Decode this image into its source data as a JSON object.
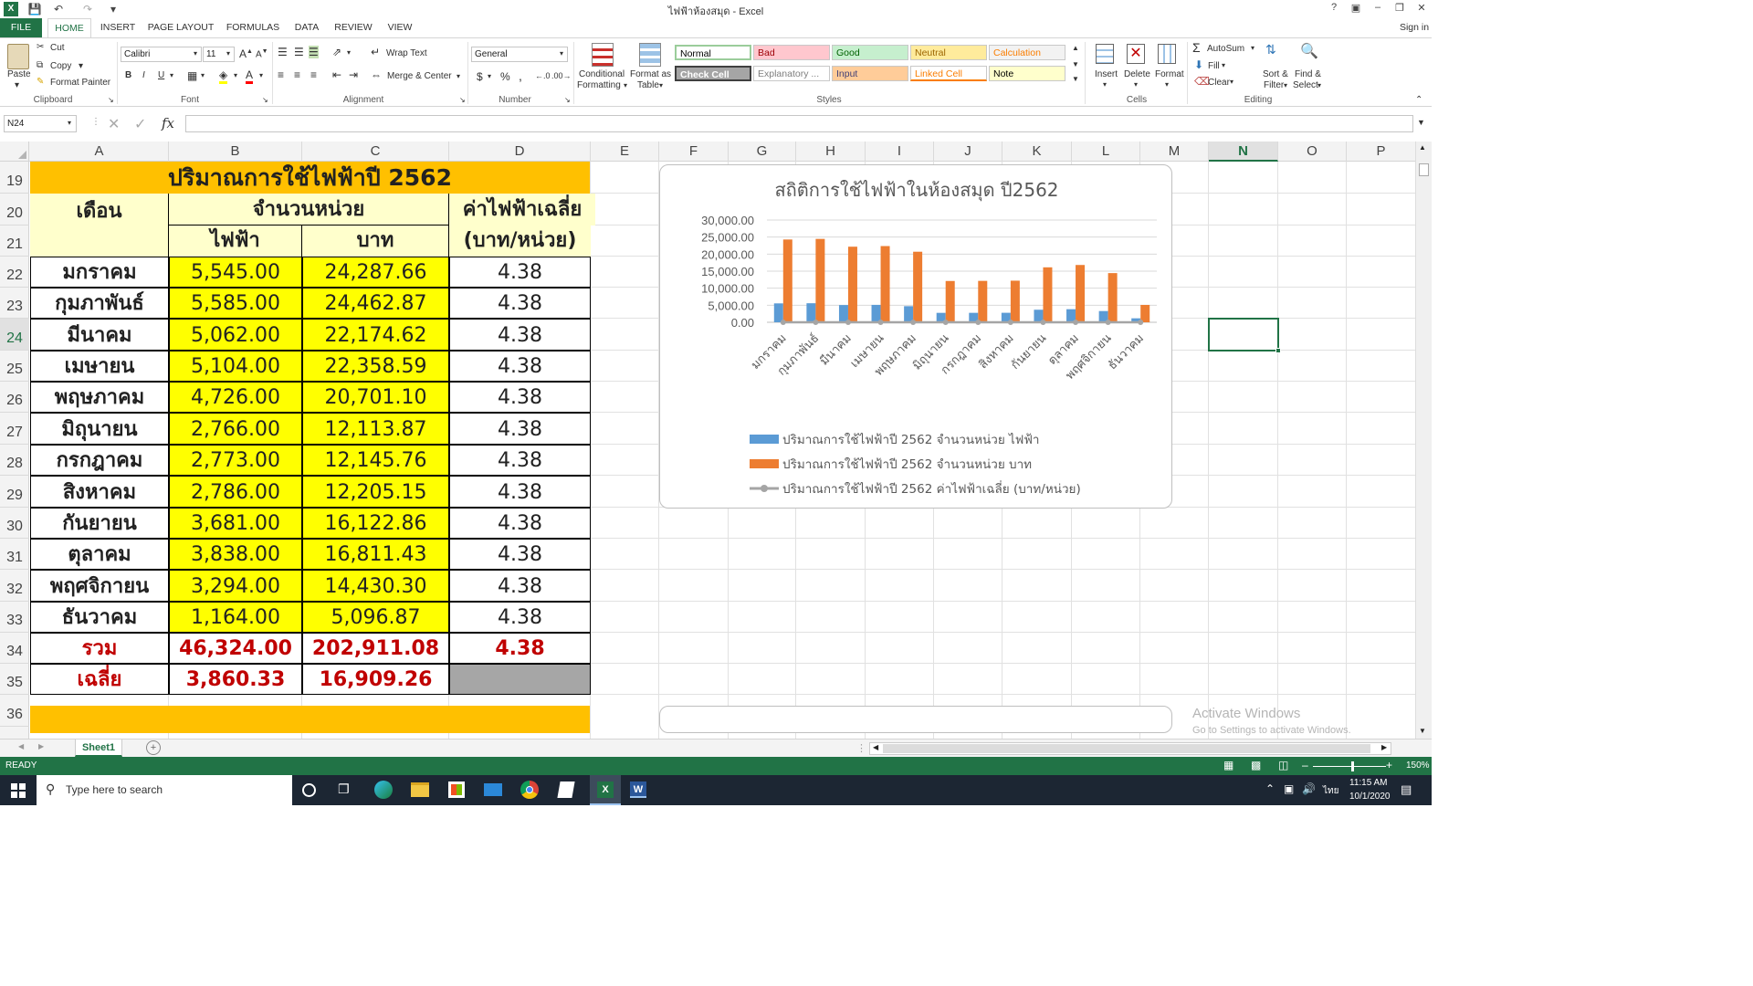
{
  "app": {
    "title": "ไฟฟ้าห้องสมุด - Excel",
    "help_icon": "?",
    "sign_in": "Sign in",
    "ribbon_tabs": [
      "FILE",
      "HOME",
      "INSERT",
      "PAGE LAYOUT",
      "FORMULAS",
      "DATA",
      "REVIEW",
      "VIEW"
    ]
  },
  "ribbon": {
    "clipboard": {
      "paste": "Paste",
      "cut": "Cut",
      "copy": "Copy",
      "format_painter": "Format Painter",
      "label": "Clipboard"
    },
    "font": {
      "name": "Calibri",
      "size": "11",
      "label": "Font"
    },
    "alignment": {
      "wrap": "Wrap Text",
      "merge": "Merge & Center",
      "label": "Alignment"
    },
    "number": {
      "format": "General",
      "label": "Number"
    },
    "styles": {
      "conditional": "Conditional",
      "conditional2": "Formatting",
      "format_as": "Format as",
      "format_as2": "Table",
      "cells": [
        {
          "name": "Normal",
          "bg": "#ffffff",
          "color": "#000000"
        },
        {
          "name": "Bad",
          "bg": "#ffc7ce",
          "color": "#9c0006"
        },
        {
          "name": "Good",
          "bg": "#c6efce",
          "color": "#006100"
        },
        {
          "name": "Neutral",
          "bg": "#ffeb9c",
          "color": "#9c6500"
        },
        {
          "name": "Calculation",
          "bg": "#f2f2f2",
          "color": "#fa7d00"
        },
        {
          "name": "Check Cell",
          "bg": "#a5a5a5",
          "color": "#ffffff"
        },
        {
          "name": "Explanatory ...",
          "bg": "#ffffff",
          "color": "#7f7f7f"
        },
        {
          "name": "Input",
          "bg": "#ffcc99",
          "color": "#3f3f76"
        },
        {
          "name": "Linked Cell",
          "bg": "#ffffff",
          "color": "#fa7d00"
        },
        {
          "name": "Note",
          "bg": "#ffffcc",
          "color": "#000000"
        }
      ],
      "label": "Styles"
    },
    "cells": {
      "insert": "Insert",
      "delete": "Delete",
      "format": "Format",
      "label": "Cells"
    },
    "editing": {
      "autosum": "AutoSum",
      "fill": "Fill",
      "clear": "Clear",
      "sort": "Sort &",
      "sort2": "Filter",
      "find": "Find &",
      "find2": "Select",
      "label": "Editing"
    }
  },
  "formula_bar": {
    "name_box": "N24",
    "fx": "fx",
    "content": ""
  },
  "columns": [
    "A",
    "B",
    "C",
    "D",
    "E",
    "F",
    "G",
    "H",
    "I",
    "J",
    "K",
    "L",
    "M",
    "N",
    "O",
    "P"
  ],
  "rows": [
    "19",
    "20",
    "21",
    "22",
    "23",
    "24",
    "25",
    "26",
    "27",
    "28",
    "29",
    "30",
    "31",
    "32",
    "33",
    "34",
    "35",
    "36"
  ],
  "table": {
    "title": "ปริมาณการใช้ไฟฟ้าปี 2562",
    "h_month": "เดือน",
    "h_units": "จำนวนหน่วย",
    "h_avg": "ค่าไฟฟ้าเฉลี่ย",
    "h_elec": "ไฟฟ้า",
    "h_baht": "บาท",
    "h_avg2": "(บาท/หน่วย)",
    "data": [
      [
        "มกราคม",
        "5,545.00",
        "24,287.66",
        "4.38"
      ],
      [
        "กุมภาพันธ์",
        "5,585.00",
        "24,462.87",
        "4.38"
      ],
      [
        "มีนาคม",
        "5,062.00",
        "22,174.62",
        "4.38"
      ],
      [
        "เมษายน",
        "5,104.00",
        "22,358.59",
        "4.38"
      ],
      [
        "พฤษภาคม",
        "4,726.00",
        "20,701.10",
        "4.38"
      ],
      [
        "มิถุนายน",
        "2,766.00",
        "12,113.87",
        "4.38"
      ],
      [
        "กรกฎาคม",
        "2,773.00",
        "12,145.76",
        "4.38"
      ],
      [
        "สิงหาคม",
        "2,786.00",
        "12,205.15",
        "4.38"
      ],
      [
        "กันยายน",
        "3,681.00",
        "16,122.86",
        "4.38"
      ],
      [
        "ตุลาคม",
        "3,838.00",
        "16,811.43",
        "4.38"
      ],
      [
        "พฤศจิกายน",
        "3,294.00",
        "14,430.30",
        "4.38"
      ],
      [
        "ธันวาคม",
        "1,164.00",
        "5,096.87",
        "4.38"
      ]
    ],
    "total": [
      "รวม",
      "46,324.00",
      "202,911.08",
      "4.38"
    ],
    "avg": [
      "เฉลี่ย",
      "3,860.33",
      "16,909.26",
      ""
    ]
  },
  "colors": {
    "title_bg": "#ffc000",
    "header_bg": "#ffffcc",
    "data_bg": "#ffff00",
    "total_text": "#c00000",
    "excel_green": "#217346",
    "avg_empty_bg": "#a6a6a6"
  },
  "chart_data": {
    "type": "bar",
    "title": "สถิติการใช้ไฟฟ้าในห้องสมุด ปี2562",
    "categories": [
      "มกราคม",
      "กุมภาพันธ์",
      "มีนาคม",
      "เมษายน",
      "พฤษภาคม",
      "มิถุนายน",
      "กรกฎาคม",
      "สิงหาคม",
      "กันยายน",
      "ตุลาคม",
      "พฤศจิกายน",
      "ธันวาคม"
    ],
    "y_ticks": [
      "30,000.00",
      "25,000.00",
      "20,000.00",
      "15,000.00",
      "10,000.00",
      "5,000.00",
      "0.00"
    ],
    "ylim": [
      0,
      30000
    ],
    "series": [
      {
        "name": "ปริมาณการใช้ไฟฟ้าปี 2562 จำนวนหน่วย ไฟฟ้า",
        "color": "#5b9bd5",
        "kind": "bar",
        "values": [
          5545,
          5585,
          5062,
          5104,
          4726,
          2766,
          2773,
          2786,
          3681,
          3838,
          3294,
          1164
        ]
      },
      {
        "name": "ปริมาณการใช้ไฟฟ้าปี 2562 จำนวนหน่วย บาท",
        "color": "#ed7d31",
        "kind": "bar",
        "values": [
          24287.66,
          24462.87,
          22174.62,
          22358.59,
          20701.1,
          12113.87,
          12145.76,
          12205.15,
          16122.86,
          16811.43,
          14430.3,
          5096.87
        ]
      },
      {
        "name": "ปริมาณการใช้ไฟฟ้าปี 2562 ค่าไฟฟ้าเฉลี่ย (บาท/หน่วย)",
        "color": "#a5a5a5",
        "kind": "line",
        "values": [
          4.38,
          4.38,
          4.38,
          4.38,
          4.38,
          4.38,
          4.38,
          4.38,
          4.38,
          4.38,
          4.38,
          4.38
        ]
      }
    ],
    "legend": "bottom",
    "grid": true
  },
  "watermark": {
    "line1": "Activate Windows",
    "line2": "Go to Settings to activate Windows."
  },
  "sheetbar": {
    "sheet": "Sheet1"
  },
  "status": {
    "ready": "READY",
    "zoom": "150%"
  },
  "taskbar": {
    "search": "Type here to search",
    "time": "11:15 AM",
    "date": "10/1/2020",
    "lang": "ไทย"
  }
}
